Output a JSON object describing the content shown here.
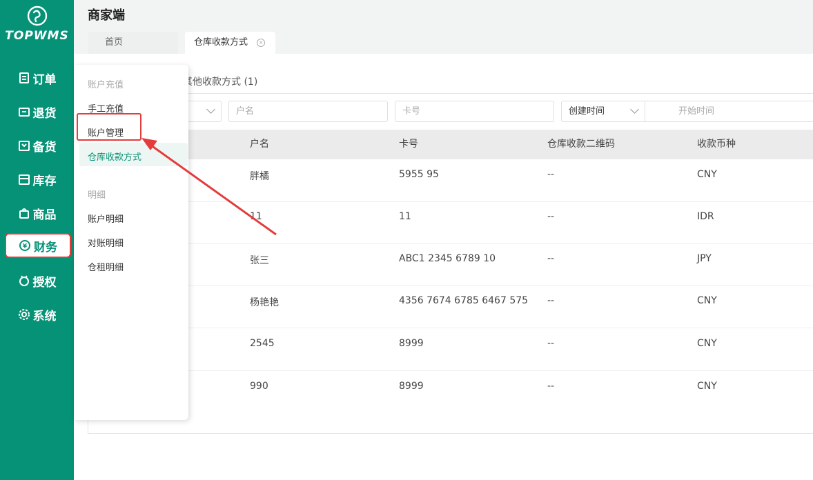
{
  "brand": {
    "name": "TOPWMS"
  },
  "nav": [
    {
      "label": "订单",
      "icon": "order-icon"
    },
    {
      "label": "退货",
      "icon": "return-icon"
    },
    {
      "label": "备货",
      "icon": "stock-prep-icon"
    },
    {
      "label": "库存",
      "icon": "inventory-icon"
    },
    {
      "label": "商品",
      "icon": "product-icon"
    },
    {
      "label": "财务",
      "icon": "finance-icon"
    },
    {
      "label": "授权",
      "icon": "auth-icon"
    },
    {
      "label": "系统",
      "icon": "settings-icon"
    }
  ],
  "header": {
    "title": "商家端"
  },
  "tabs": [
    {
      "label": "首页"
    },
    {
      "label": "仓库收款方式"
    }
  ],
  "subtab": {
    "label": "其他收款方式 (1)"
  },
  "filters": {
    "name_placeholder": "户名",
    "card_placeholder": "卡号",
    "date_type": "创建时间",
    "start_placeholder": "开始时间"
  },
  "table": {
    "columns": [
      "户名",
      "卡号",
      "仓库收款二维码",
      "收款币种"
    ],
    "rows": [
      {
        "name": "胖橘",
        "card": "5955 95",
        "qr": "--",
        "currency": "CNY"
      },
      {
        "name": "11",
        "card": "11",
        "qr": "--",
        "currency": "IDR"
      },
      {
        "name": "张三",
        "card": "ABC1 2345 6789 10",
        "qr": "--",
        "currency": "JPY"
      },
      {
        "name": "杨艳艳",
        "card": "4356 7674 6785 6467 575",
        "qr": "--",
        "currency": "CNY"
      },
      {
        "name": "2545",
        "card": "8999",
        "qr": "--",
        "currency": "CNY"
      },
      {
        "name": "990",
        "card": "8999",
        "qr": "--",
        "currency": "CNY"
      }
    ]
  },
  "flyout": {
    "group1": "账户充值",
    "items1": [
      "手工充值",
      "账户管理",
      "仓库收款方式"
    ],
    "group2": "明细",
    "items2": [
      "账户明细",
      "对账明细",
      "仓租明细"
    ]
  },
  "colors": {
    "primary": "#069277",
    "highlight": "#e43b3b"
  }
}
